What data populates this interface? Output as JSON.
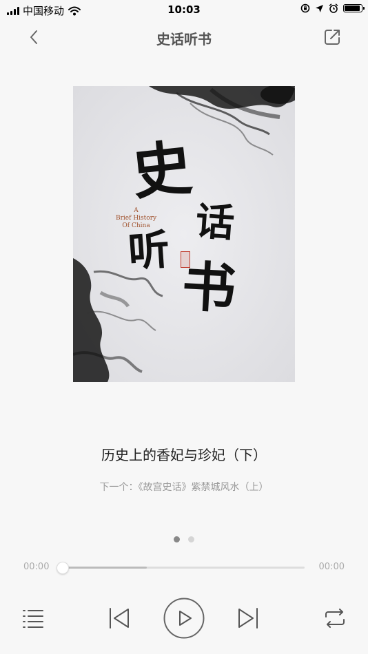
{
  "status_bar": {
    "carrier": "中国移动",
    "time": "10:03",
    "signal_bars": 4,
    "battery_level": 0.9
  },
  "nav": {
    "title": "史话听书",
    "back_icon": "chevron-left-icon",
    "share_icon": "share-icon"
  },
  "cover": {
    "calligraphy": [
      "史",
      "话",
      "听",
      "书"
    ],
    "english_lines": [
      "A",
      "Brief History",
      "Of China"
    ],
    "seal_color": "#c0392b"
  },
  "player": {
    "track_title": "历史上的香妃与珍妃（下）",
    "next_label": "下一个：《故宫史话》紫禁城风水（上）",
    "page_dots": {
      "count": 2,
      "active": 0
    },
    "time_elapsed": "00:00",
    "time_total": "00:00",
    "buffered_fraction": 0.35,
    "played_fraction": 0
  },
  "controls": {
    "playlist_icon": "playlist-icon",
    "previous_icon": "previous-icon",
    "play_icon": "play-icon",
    "next_icon": "next-icon",
    "repeat_icon": "repeat-icon"
  },
  "colors": {
    "background": "#f7f7f7",
    "icon": "#555555",
    "muted": "#999999"
  }
}
